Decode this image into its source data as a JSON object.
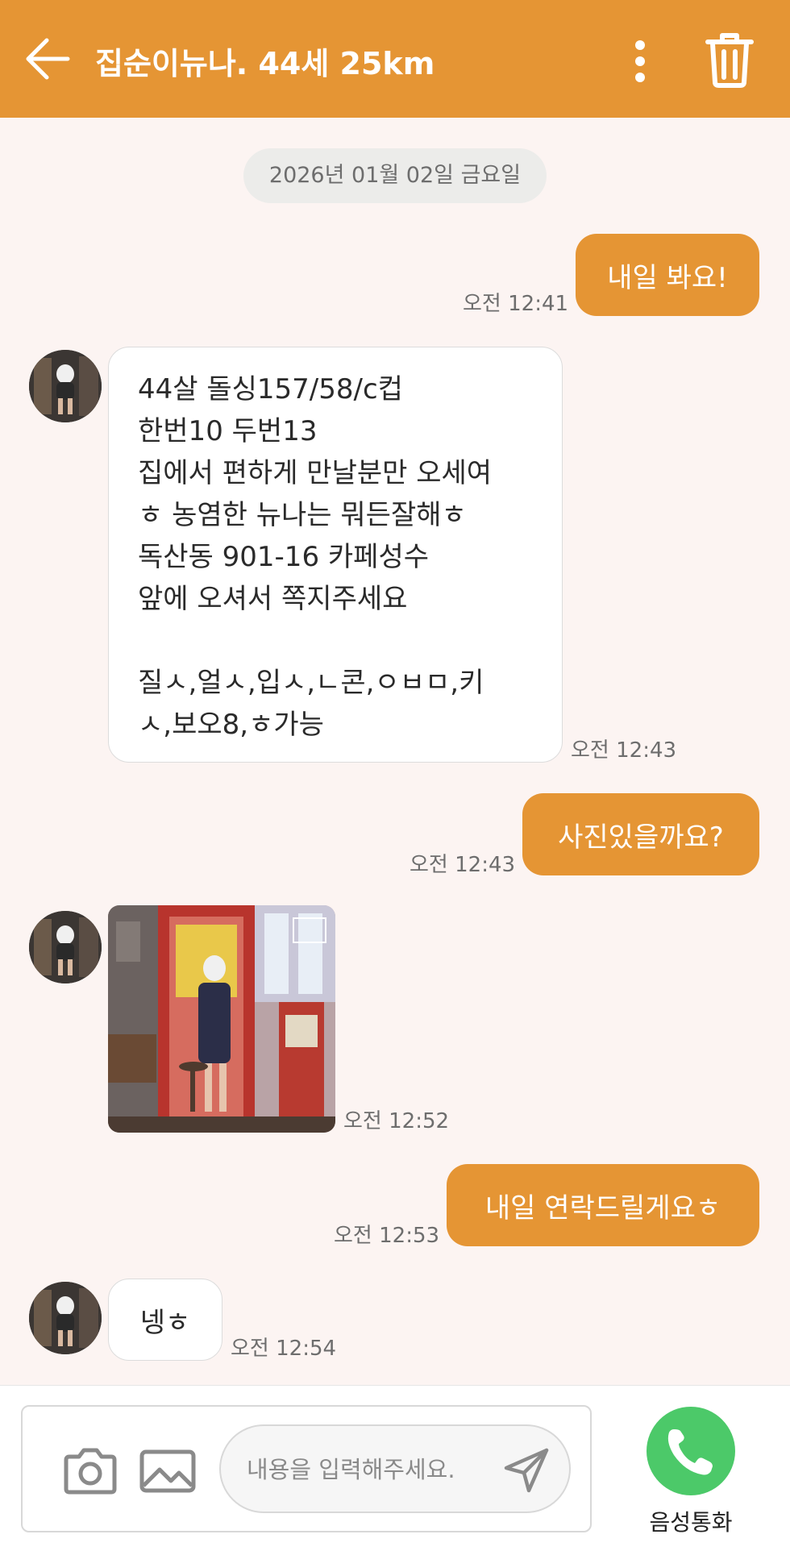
{
  "header": {
    "title": "집순이뉴나. 44세 25km"
  },
  "chat": {
    "date": "2026년 01월 02일 금요일",
    "messages": {
      "m1": {
        "text": "내일 봐요!",
        "time": "오전 12:41"
      },
      "m2": {
        "lines": [
          "44살 돌싱157/58/c컵",
          "한번10 두번13",
          "집에서 편하게 만날분만 오세여",
          "ㅎ 농염한 뉴나는 뭐든잘해ㅎ",
          "독산동 901-16 카페성수",
          "앞에 오셔서 쪽지주세요",
          "",
          "질ㅅ,얼ㅅ,입ㅅ,ㄴ콘,ㅇㅂㅁ,키",
          "ㅅ,보오8,ㅎ가능"
        ],
        "time": "오전 12:43"
      },
      "m3": {
        "text": "사진있을까요?",
        "time": "오전 12:43"
      },
      "m4": {
        "time": "오전 12:52"
      },
      "m5": {
        "text": "내일 연락드릴게요ㅎ",
        "time": "오전 12:53"
      },
      "m6": {
        "text": "넹ㅎ",
        "time": "오전 12:54"
      }
    }
  },
  "composer": {
    "placeholder": "내용을 입력해주세요.",
    "call_label": "음성통화"
  },
  "colors": {
    "accent": "#e59534",
    "background": "#fcf4f2",
    "call_green": "#4cc969"
  },
  "icons": [
    "back-arrow-icon",
    "more-vertical-icon",
    "trash-icon",
    "camera-icon",
    "image-icon",
    "send-icon",
    "phone-icon"
  ]
}
